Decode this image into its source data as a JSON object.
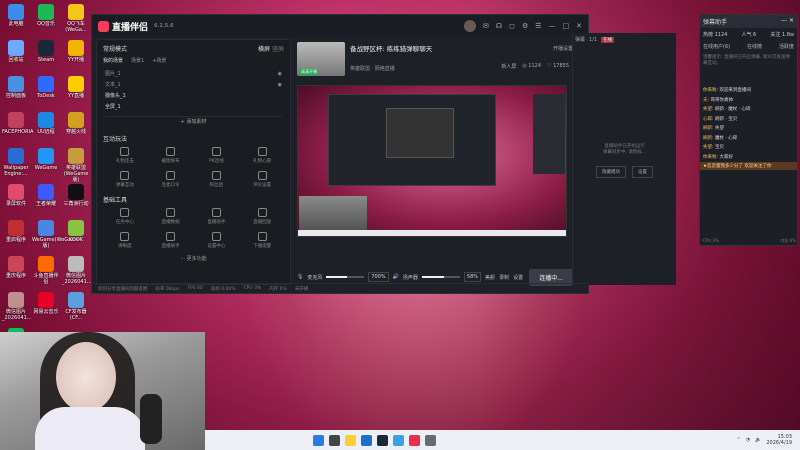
{
  "desktop_icons": [
    {
      "label": "此电脑",
      "color": "#3b8ee8"
    },
    {
      "label": "QQ音乐",
      "color": "#1db954"
    },
    {
      "label": "QQ飞车(WeGa...",
      "color": "#f5c518"
    },
    {
      "label": "回收站",
      "color": "#6ea8ff"
    },
    {
      "label": "Steam",
      "color": "#1b2838"
    },
    {
      "label": "YY开播",
      "color": "#f4b400"
    },
    {
      "label": "控制面板",
      "color": "#4a90e2"
    },
    {
      "label": "ToDesk",
      "color": "#2f6bff"
    },
    {
      "label": "YY直播",
      "color": "#ffcc00"
    },
    {
      "label": "FACEPHORIA",
      "color": "#c04060"
    },
    {
      "label": "UU远程",
      "color": "#1e88e5"
    },
    {
      "label": "穿越火线",
      "color": "#d4a020"
    },
    {
      "label": "Wallpaper Engine:...",
      "color": "#2a6cd6"
    },
    {
      "label": "WeGame",
      "color": "#2196f3"
    },
    {
      "label": "英雄联盟(WeGame版)",
      "color": "#c89b3c"
    },
    {
      "label": "录屏软件",
      "color": "#e24a70"
    },
    {
      "label": "王者荣耀",
      "color": "#3d5afe"
    },
    {
      "label": "三角洲行动",
      "color": "#111111"
    },
    {
      "label": "重启程序",
      "color": "#c03030"
    },
    {
      "label": "WeGame(WeGame版)",
      "color": "#4b86e4"
    },
    {
      "label": "KOOK",
      "color": "#87c540"
    },
    {
      "label": "重庆程序",
      "color": "#cc4455"
    },
    {
      "label": "斗鱼直播伴侣",
      "color": "#ff6a00"
    },
    {
      "label": "微信图片_2026041...",
      "color": "#bbbbbb"
    },
    {
      "label": "微信图片_2026041...",
      "color": "#c09090"
    },
    {
      "label": "网易云音乐",
      "color": "#e60026"
    },
    {
      "label": "CF发布器(CF...",
      "color": "#5aa0e0"
    },
    {
      "label": "微信",
      "color": "#07c160"
    }
  ],
  "window": {
    "app_name": "直播伴侣",
    "version": "6.1.5.6"
  },
  "left_panel": {
    "mode_label": "常规模式",
    "mode_tabs": [
      "横屏",
      "竖屏"
    ],
    "sub_tabs": [
      "我的场景",
      "场景1",
      "+场景"
    ],
    "sources": [
      "图片_1",
      "文本_1",
      "摄像头_1",
      "全屏_1"
    ],
    "add_material": "+ 添加素材",
    "interact_title": "互动玩法",
    "interact_items": [
      "礼物连击",
      "截图发布",
      "PK连线",
      "礼物心愿",
      "弹幕互动",
      "连麦口令",
      "粉丝团",
      "评论设置"
    ],
    "tools_title": "基础工具",
    "tools_items": [
      "任务中心",
      "直播数据",
      "直播助手",
      "直播回放",
      "清晰度",
      "直播助手",
      "设置中心",
      "下播提醒"
    ],
    "more_label": "··· 更多功能"
  },
  "stream_info": {
    "title": "备战野区杯: 练练猎弹聊聊天",
    "category": "英雄联盟 · 隔绝直播",
    "thumb_tag": "高清开播",
    "views": "1124",
    "likes": "17855",
    "share_label": "开播设置",
    "new_label": "新人屏"
  },
  "controls": {
    "mic_label": "麦克风",
    "mic_pct": "700%",
    "mic_level": 0.55,
    "speaker_label": "扬声器",
    "speaker_pct": "58%",
    "speaker_level": 0.58,
    "beauty_label": "美颜",
    "record_label": "录制",
    "settings_label": "设置",
    "start_button": "连播中..."
  },
  "status_bar": [
    "如何分享直播间到朋友圈",
    "码率 0kbps",
    "FPS 60",
    "丢帧 0.00%",
    "CPU 3%",
    "内存 6%",
    "未开播"
  ],
  "right_pane": {
    "tabs": [
      "弹幕",
      "1/1"
    ],
    "badge": "在线",
    "msg_line1": "直播助手已开始运行",
    "msg_line2": "弹幕同步中, 请稍候...",
    "btn1": "隐藏模块",
    "btn2": "设置"
  },
  "helper": {
    "title": "弹幕助手",
    "stats": [
      "热榜 1124",
      "人气 6",
      "关注 1.8w"
    ],
    "tabs": [
      "在线用户(6)",
      "在线榜",
      "活跃度"
    ],
    "note": "温馨提示: 直播间已开启弹幕, 观众可发送弹幕互动。",
    "chat": [
      {
        "name": "你来啦",
        "text": "欢迎来到直播间"
      },
      {
        "name": "天",
        "text": "哥哥你真帅"
      },
      {
        "name": "失望",
        "text": "刷新 · 魔杖 · 心碎"
      },
      {
        "name": "心碎",
        "text": "刷新 · 宝贝"
      },
      {
        "name": "刷新",
        "text": "失望"
      },
      {
        "name": "刷新",
        "text": "魔杖 · 心碎"
      },
      {
        "name": "失望",
        "text": "宝贝"
      },
      {
        "name": "你来啦",
        "text": "大家好"
      }
    ],
    "ticker": "★恋恋蜜我多少分了 欢迎关注了你",
    "footer_left": "CPU 3%",
    "footer_right": "内存 6%"
  },
  "taskbar": {
    "icons": [
      "#2a7be4",
      "#444444",
      "#ffcc33",
      "#1f6fd1",
      "#1b2838",
      "#3aa0e8",
      "#e8304b",
      "#6a6a6a"
    ],
    "time": "15:03",
    "date": "2026/4/19"
  }
}
